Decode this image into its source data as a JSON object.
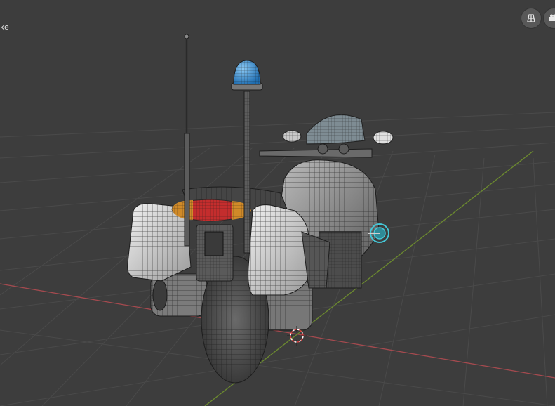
{
  "viewport": {
    "object_label": "ke",
    "background_color": "#3d3d3d",
    "grid_color": "#4a4a4a",
    "x_axis_color": "#a54a4f",
    "y_axis_color": "#6c8a2f"
  },
  "header_buttons": [
    {
      "name": "toggle-grid-view",
      "icon": "grid-icon"
    },
    {
      "name": "camera-view",
      "icon": "camera-icon"
    }
  ],
  "scene": {
    "object": "motorcycle",
    "shading": "wireframe-overlay",
    "beacon_color": "#3a8fd6",
    "tail_light_colors": [
      "#d08a28",
      "#c42d2d"
    ],
    "selected_empty_color": "#45c8d8",
    "origin_cursor_color": "#d23b3b"
  }
}
